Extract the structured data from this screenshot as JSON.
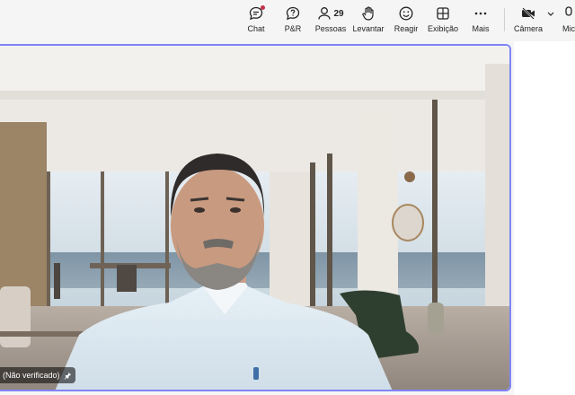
{
  "toolbar": {
    "chat": {
      "label": "Chat",
      "icon": "chat-icon",
      "has_notification": true
    },
    "qa": {
      "label": "P&R",
      "icon": "question-icon"
    },
    "people": {
      "label": "Pessoas",
      "count": "29",
      "icon": "people-icon"
    },
    "raise_hand": {
      "label": "Levantar",
      "icon": "hand-icon"
    },
    "react": {
      "label": "Reagir",
      "icon": "emoji-icon"
    },
    "view": {
      "label": "Exibição",
      "icon": "grid-icon"
    },
    "more": {
      "label": "Mais",
      "icon": "more-icon"
    },
    "camera": {
      "label": "Câmera",
      "icon": "camera-off-icon"
    },
    "mic": {
      "label": "Micr",
      "icon": "mic-icon"
    }
  },
  "video": {
    "participant_label": "(Não verificado)",
    "pin_icon": "pin-icon"
  },
  "colors": {
    "active_speaker_border": "#7f85f5",
    "notification_dot": "#c4314b"
  }
}
